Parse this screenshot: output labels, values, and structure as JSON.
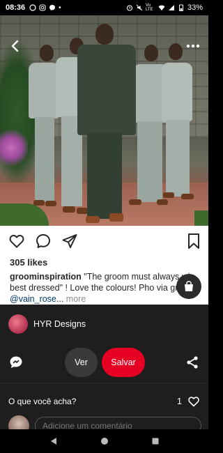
{
  "status_bar": {
    "time": "08:36",
    "battery": "33%",
    "network": "Vo LTE"
  },
  "instagram": {
    "likes": "305 likes",
    "username": "groominspiration",
    "caption": " \"The groom must always win best dressed\" ! Love the colours! Pho via groom ",
    "mention": "@vain_rose",
    "ellipsis": "... ",
    "more": "more"
  },
  "pin": {
    "author_name": "HYR Designs",
    "ver_label": "Ver",
    "salvar_label": "Salvar",
    "comments_prompt": "O que você acha?",
    "reaction_count": "1",
    "comment_placeholder": "Adicione um comentário"
  },
  "colors": {
    "salvar": "#e60023",
    "dark_bg": "#1e1e1e"
  }
}
